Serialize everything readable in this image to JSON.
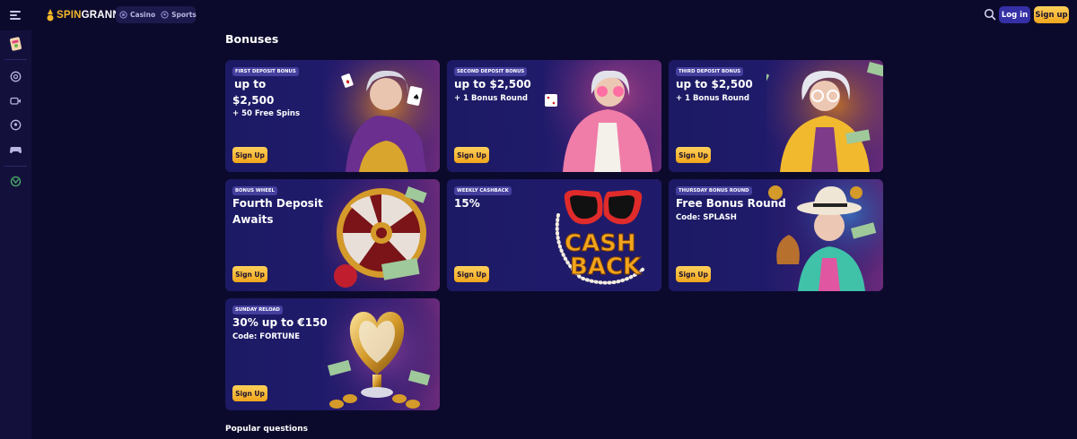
{
  "header": {
    "logo": {
      "part1": "SPIN",
      "part2": "GRANNY"
    },
    "tabs": [
      {
        "label": "Casino",
        "icon": "casino-chip-icon"
      },
      {
        "label": "Sports",
        "icon": "sports-ball-icon"
      }
    ],
    "login_label": "Log in",
    "signup_label": "Sign up"
  },
  "sidebar": {
    "items": [
      "promo-icon",
      "casino-icon",
      "live-casino-icon",
      "sports-icon",
      "games-icon",
      "esports-icon"
    ]
  },
  "page": {
    "title": "Bonuses",
    "popular_title": "Popular questions"
  },
  "bonuses": [
    {
      "tag": "First Deposit Bonus",
      "line1": "up to",
      "line2": "$2,500",
      "small": "+ 50 Free Spins",
      "cta": "Sign Up"
    },
    {
      "tag": "Second Deposit Bonus",
      "line1": "up to  $2,500",
      "small": "+ 1 Bonus Round",
      "cta": "Sign Up"
    },
    {
      "tag": "Third Deposit Bonus",
      "line1": "up to  $2,500",
      "small": "+ 1 Bonus Round",
      "cta": "Sign Up"
    },
    {
      "tag": "Bonus Wheel",
      "line1": "Fourth Deposit",
      "line2": "Awaits",
      "cta": "Sign Up"
    },
    {
      "tag": "Weekly Cashback",
      "line1": "15%",
      "cta": "Sign Up",
      "art_text1": "CASH",
      "art_text2": "BACK"
    },
    {
      "tag": "Thursday Bonus Round",
      "line1": "Free Bonus Round",
      "small": "Code: SPLASH",
      "cta": "Sign Up"
    },
    {
      "tag": "Sunday Reload",
      "line1": "30% up to €150",
      "small": "Code: FORTUNE",
      "cta": "Sign Up"
    }
  ],
  "colors": {
    "background": "#0c0a2c",
    "sidebar": "#13113c",
    "accent_yellow": "#f0a51c",
    "login_button": "#3530a5"
  }
}
